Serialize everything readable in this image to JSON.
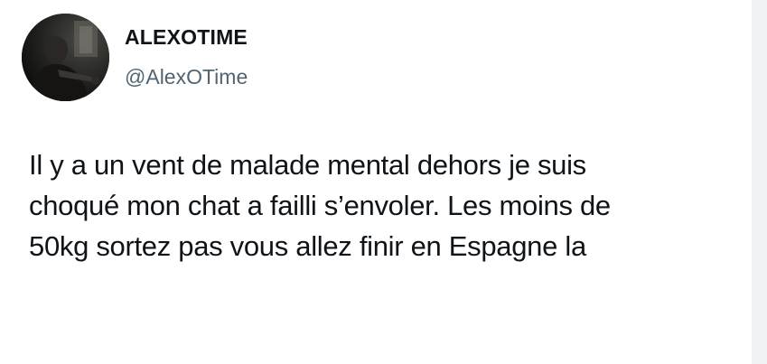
{
  "author": {
    "display_name": "ALEXOTIME",
    "handle": "@AlexOTime"
  },
  "tweet": {
    "lines": [
      "Il y a un vent de malade mental dehors je suis",
      "choqué mon chat a failli s’envoler. Les moins de",
      "50kg sortez pas vous allez finir en Espagne la"
    ]
  },
  "colors": {
    "text": "#0f1419",
    "handle": "#536471",
    "background": "#ffffff",
    "side_strip": "#f0f2f5"
  }
}
